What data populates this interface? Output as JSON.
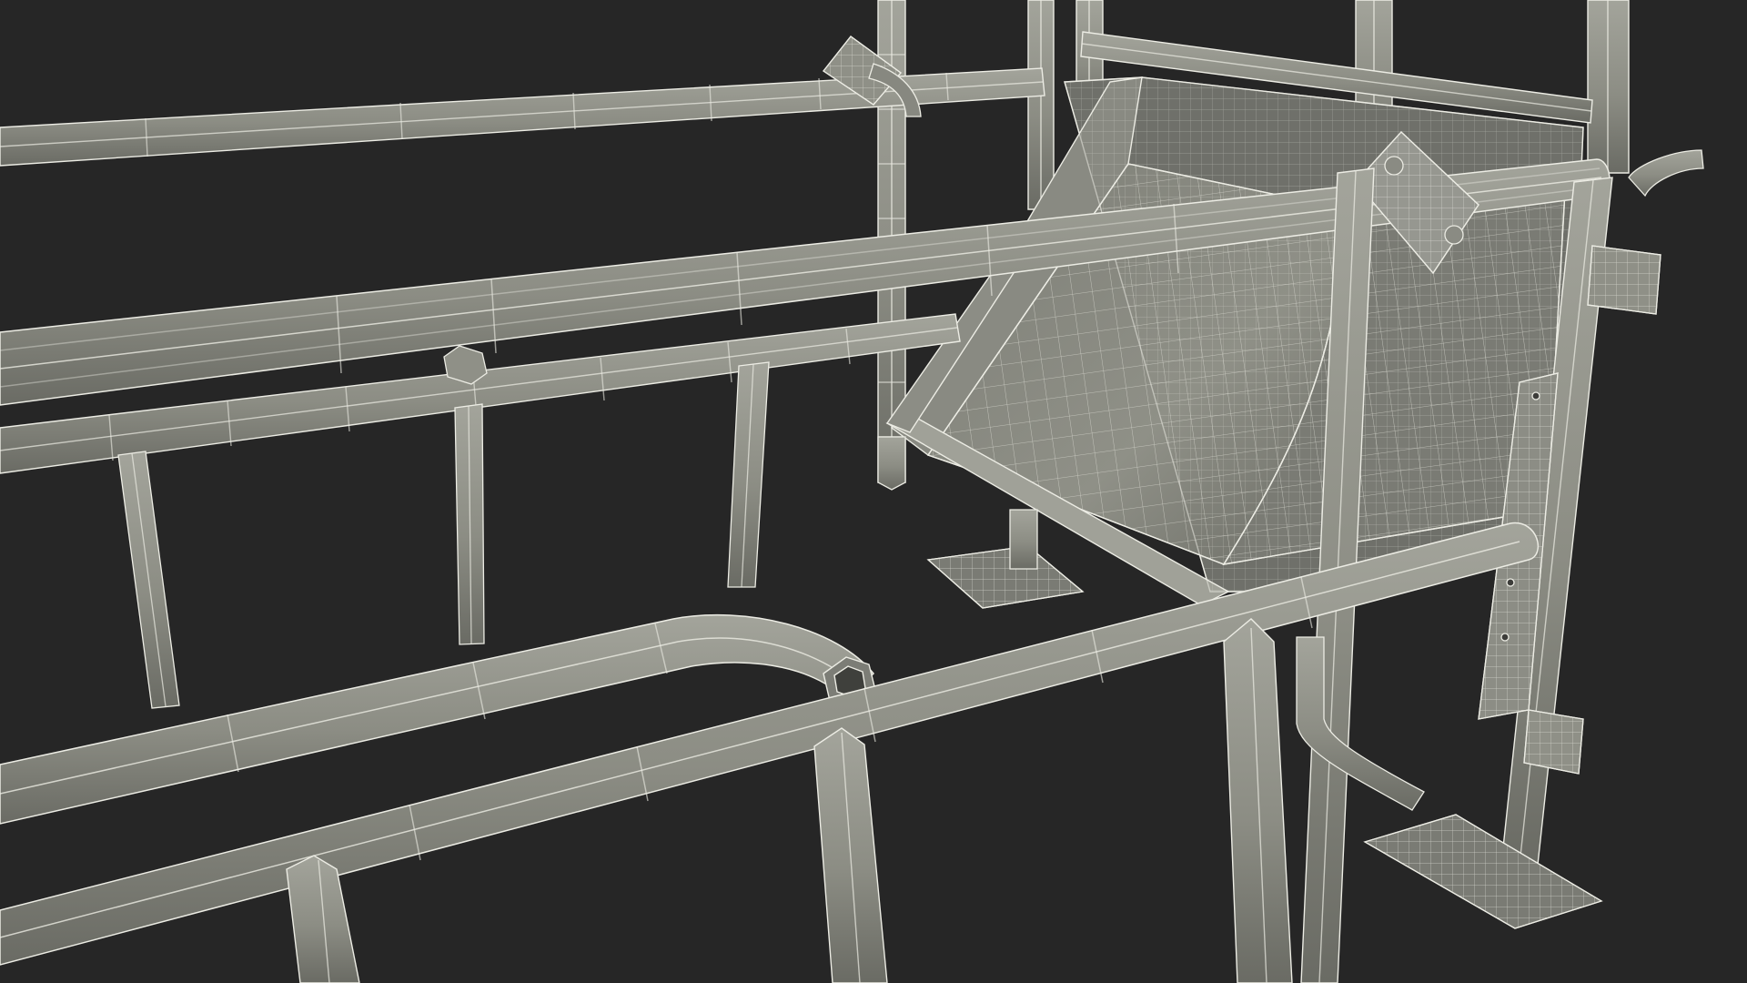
{
  "scene": {
    "subject": "wireframe-render-livestock-stall-with-feeder",
    "background_color": "#262626",
    "surface_color": "#8e8f86",
    "surface_shadow_color": "#5d5e57",
    "wire_color": "#ecece4"
  }
}
